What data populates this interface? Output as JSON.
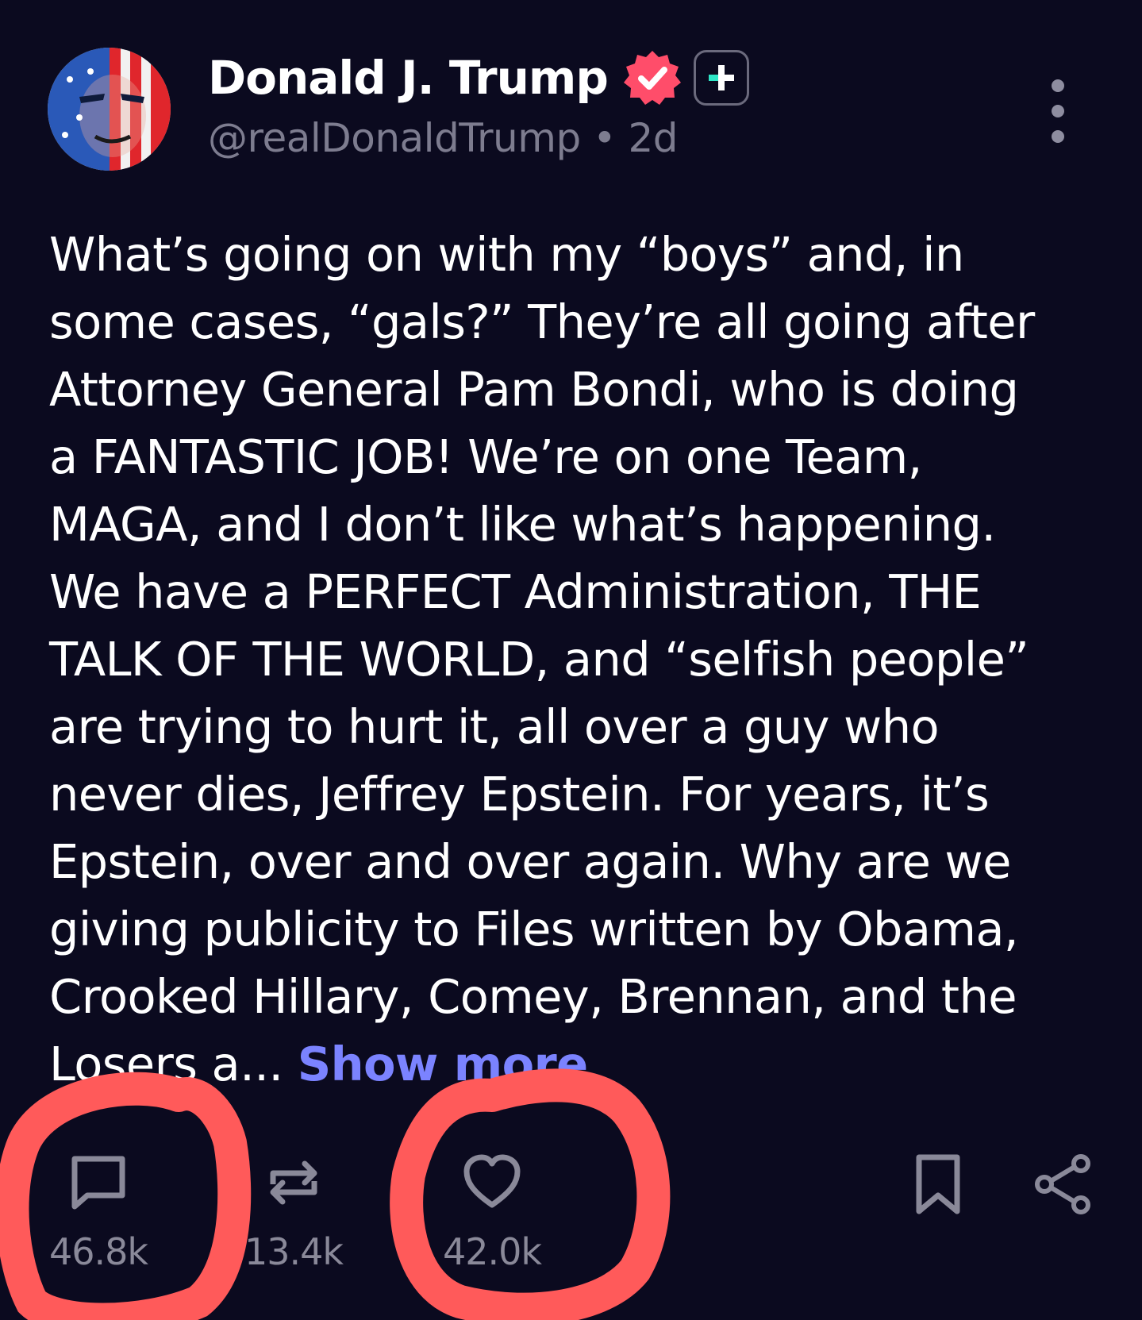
{
  "author": {
    "display_name": "Donald J. Trump",
    "handle": "@realDonaldTrump",
    "separator": "•",
    "time_ago": "2d"
  },
  "post": {
    "lines": [
      "What’s going on with my “boys” and, in",
      "some cases, “gals?” They’re all going after",
      "Attorney General Pam Bondi, who is doing",
      "a FANTASTIC JOB! We’re on one Team,",
      "MAGA, and I don’t like what’s happening.",
      "We have a PERFECT Administration, THE",
      "TALK OF THE WORLD, and “selfish people”",
      "are trying to hurt it, all over a guy who",
      "never dies, Jeffrey Epstein. For years, it’s",
      "Epstein, over and over again. Why are we",
      "giving publicity to Files written by Obama,",
      "Crooked Hillary, Comey, Brennan, and the",
      "Losers a..."
    ],
    "show_more": "Show more"
  },
  "actions": {
    "replies": "46.8k",
    "reposts": "13.4k",
    "likes": "42.0k"
  },
  "colors": {
    "background": "#0b0a1f",
    "verified_badge": "#ff4d6a",
    "accent_link": "#7b83ff",
    "annotation": "#ff5a5a",
    "muted": "#8a8999"
  },
  "icons": [
    "verified-icon",
    "plus-icon",
    "more-icon",
    "reply-icon",
    "repost-icon",
    "like-icon",
    "bookmark-icon",
    "share-icon"
  ]
}
